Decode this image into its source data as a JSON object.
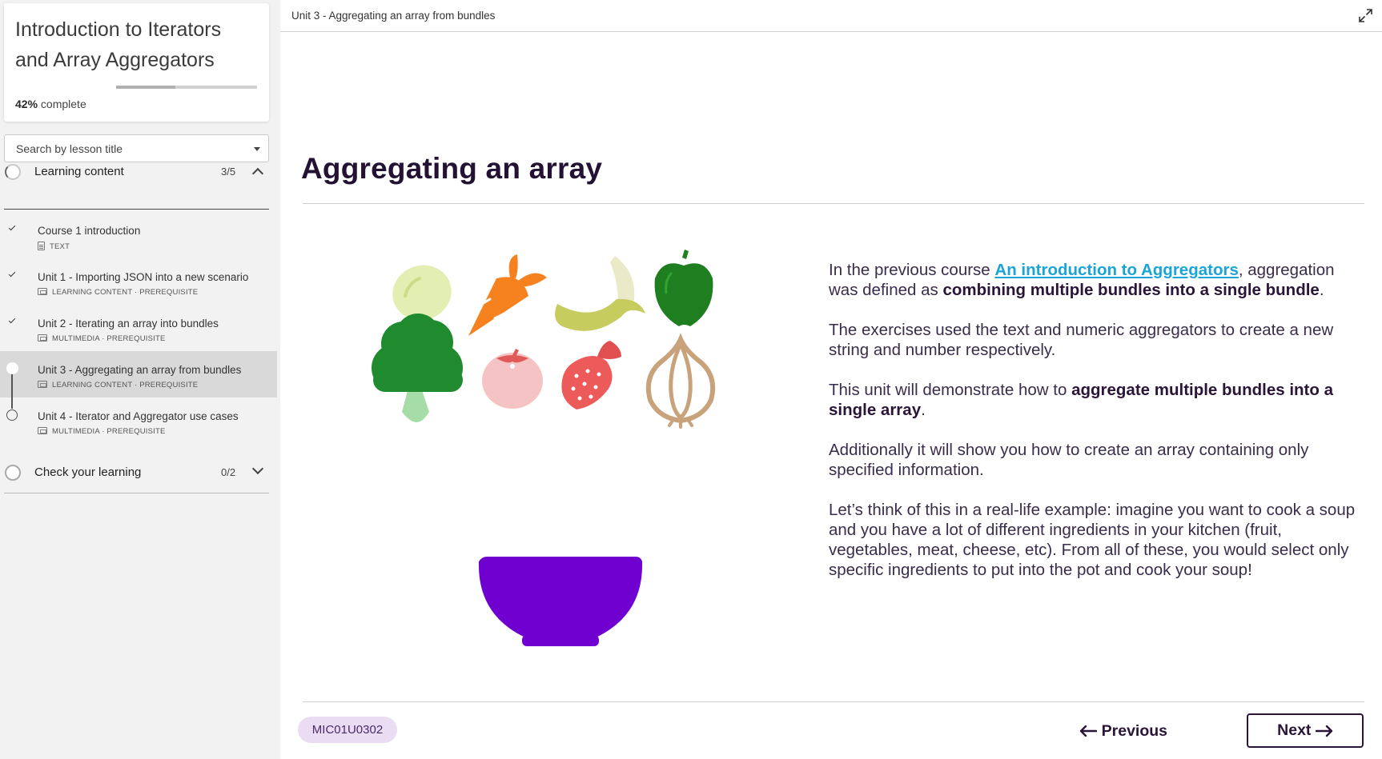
{
  "sidebar": {
    "course_title": "Introduction to Iterators and Array Aggregators",
    "progress_percent": 42,
    "progress_label": "42%",
    "progress_suffix": "complete",
    "search_placeholder": "Search by lesson title",
    "sections": [
      {
        "title": "Learning content",
        "count": "3/5",
        "expanded": true
      },
      {
        "title": "Check your learning",
        "count": "0/2",
        "expanded": false
      }
    ],
    "lessons": [
      {
        "title": "Course 1 introduction",
        "meta": "TEXT",
        "meta_icon": "document-icon",
        "status": "done"
      },
      {
        "title": "Unit 1 - Importing JSON into a new scenario",
        "meta": "LEARNING CONTENT · PREREQUISITE",
        "meta_icon": "media-icon",
        "status": "done"
      },
      {
        "title": "Unit 2 - Iterating an array into bundles",
        "meta": "MULTIMEDIA · PREREQUISITE",
        "meta_icon": "media-icon",
        "status": "done"
      },
      {
        "title": "Unit 3 - Aggregating an array from bundles",
        "meta": "LEARNING CONTENT · PREREQUISITE",
        "meta_icon": "media-icon",
        "status": "current"
      },
      {
        "title": "Unit 4 - Iterator and Aggregator use cases",
        "meta": "MULTIMEDIA · PREREQUISITE",
        "meta_icon": "media-icon",
        "status": "open"
      }
    ]
  },
  "main": {
    "breadcrumb": "Unit 3 - Aggregating an array from bundles",
    "title": "Aggregating an array",
    "paragraphs": {
      "p1_a": "In the previous course ",
      "p1_link": "An introduction to Aggregators",
      "p1_b": ", aggregation was defined as ",
      "p1_bold": "combining multiple bundles into a single bundle",
      "p1_c": ".",
      "p2": "The exercises used the text and numeric aggregators to create a new string and number respectively.",
      "p3_a": "This unit will demonstrate how to ",
      "p3_bold": "aggregate multiple bundles into a single array",
      "p3_b": ".",
      "p4": "Additionally it will show you how to create an array containing only specified information.",
      "p5": "Let’s think of this in a real-life example: imagine you want to cook a soup and you have a lot of different ingredients in your kitchen (fruit, vegetables, meat, cheese, etc). From all of these, you would select only specific ingredients to put into the pot and cook your soup!"
    },
    "illustration_icons": [
      "lemon-icon",
      "carrot-icon",
      "banana-icon",
      "apple-icon",
      "broccoli-icon",
      "tomato-icon",
      "strawberry-icon",
      "onion-icon",
      "bowl-icon"
    ],
    "code_badge": "MIC01U0302",
    "prev_label": "Previous",
    "next_label": "Next"
  },
  "colors": {
    "accent_purple": "#7000d0",
    "link_blue": "#1aa4d8",
    "title_dark": "#231233",
    "badge_bg": "#eadcf3"
  }
}
